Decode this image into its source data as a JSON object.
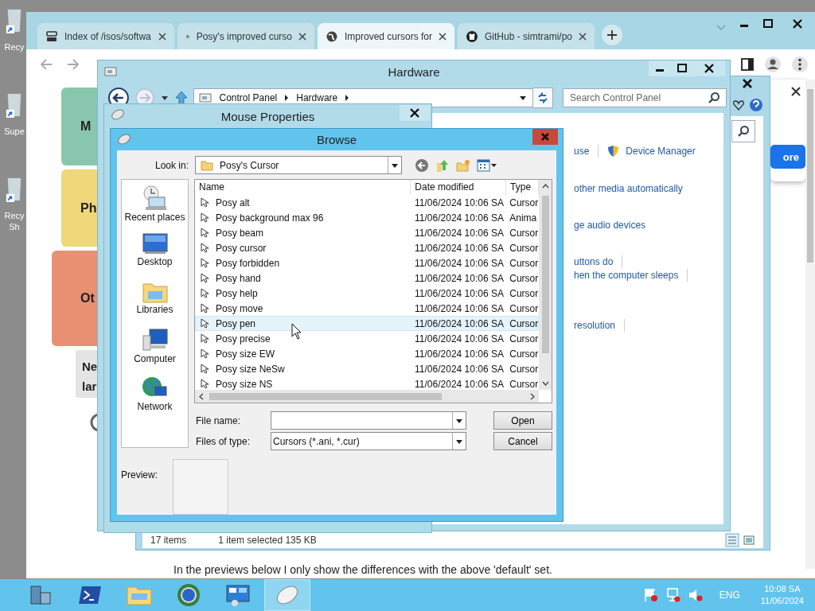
{
  "desktop_icons": [
    {
      "lines": [
        "Recy"
      ]
    },
    {
      "lines": [
        "Supe"
      ]
    },
    {
      "lines": [
        "Recy",
        "Sh"
      ]
    }
  ],
  "browser": {
    "tabs": [
      {
        "title": "Index of /isos/softwa",
        "kind": "server",
        "selected": false
      },
      {
        "title": "Posy's improved curso",
        "kind": "asterisk",
        "selected": false
      },
      {
        "title": "Improved cursors for",
        "kind": "globe",
        "selected": true
      },
      {
        "title": "GitHub - simtrami/po",
        "kind": "cat",
        "selected": false
      }
    ],
    "page": {
      "cards": [
        {
          "label": "M",
          "color": "#88c7ae"
        },
        {
          "label": "Ph",
          "color": "#efd77a"
        },
        {
          "label": "Ot",
          "color": "#e89172"
        }
      ],
      "note_lines": [
        "Ne",
        "lar"
      ],
      "popup_button": "ore",
      "paragraph": "In the previews below I only show the differences with the above 'default' set."
    }
  },
  "control_panel_back": {
    "status": [
      "17 items",
      "1 item selected  135 KB"
    ]
  },
  "hardware": {
    "title": "Hardware",
    "breadcrumb": [
      "Control Panel",
      "Hardware"
    ],
    "search_placeholder": "Search Control Panel",
    "link_rows": [
      {
        "links": [
          {
            "text": "use",
            "kind": "plain"
          },
          {
            "text": "Device Manager",
            "kind": "shield"
          }
        ],
        "trailing_separator": false
      },
      {
        "links": [
          {
            "text": "other media automatically",
            "kind": "plain"
          }
        ],
        "trailing_separator": false
      },
      {
        "links": [
          {
            "text": "ge audio devices",
            "kind": "plain"
          }
        ],
        "trailing_separator": false
      },
      {
        "links": [
          {
            "text": "uttons do",
            "kind": "plain"
          }
        ],
        "trailing_separator": true
      },
      {
        "links": [
          {
            "text": "hen the computer sleeps",
            "kind": "plain"
          }
        ],
        "trailing_separator": true
      },
      {
        "links": [
          {
            "text": "resolution",
            "kind": "plain"
          }
        ],
        "trailing_separator": true
      }
    ]
  },
  "mouse_properties": {
    "title": "Mouse Properties"
  },
  "browse": {
    "title": "Browse",
    "look_in_label": "Look in:",
    "look_in": "Posy's Cursor",
    "places": [
      {
        "label": "Recent places",
        "kind": "recent"
      },
      {
        "label": "Desktop",
        "kind": "desktop"
      },
      {
        "label": "Libraries",
        "kind": "libraries"
      },
      {
        "label": "Computer",
        "kind": "computer"
      },
      {
        "label": "Network",
        "kind": "network"
      }
    ],
    "columns": [
      "Name",
      "Date modified",
      "Type"
    ],
    "files": [
      {
        "name": "Posy alt",
        "date": "11/06/2024 10:06 SA",
        "type": "Cursor",
        "hovered": false
      },
      {
        "name": "Posy background max 96",
        "date": "11/06/2024 10:06 SA",
        "type": "Anima",
        "hovered": false
      },
      {
        "name": "Posy beam",
        "date": "11/06/2024 10:06 SA",
        "type": "Cursor",
        "hovered": false
      },
      {
        "name": "Posy cursor",
        "date": "11/06/2024 10:06 SA",
        "type": "Cursor",
        "hovered": false
      },
      {
        "name": "Posy forbidden",
        "date": "11/06/2024 10:06 SA",
        "type": "Cursor",
        "hovered": false
      },
      {
        "name": "Posy hand",
        "date": "11/06/2024 10:06 SA",
        "type": "Cursor",
        "hovered": false
      },
      {
        "name": "Posy help",
        "date": "11/06/2024 10:06 SA",
        "type": "Cursor",
        "hovered": false
      },
      {
        "name": "Posy move",
        "date": "11/06/2024 10:06 SA",
        "type": "Cursor",
        "hovered": false
      },
      {
        "name": "Posy pen",
        "date": "11/06/2024 10:06 SA",
        "type": "Cursor",
        "hovered": true
      },
      {
        "name": "Posy precise",
        "date": "11/06/2024 10:06 SA",
        "type": "Cursor",
        "hovered": false
      },
      {
        "name": "Posy size EW",
        "date": "11/06/2024 10:06 SA",
        "type": "Cursor",
        "hovered": false
      },
      {
        "name": "Posy size NeSw",
        "date": "11/06/2024 10:06 SA",
        "type": "Cursor",
        "hovered": false
      },
      {
        "name": "Posy size NS",
        "date": "11/06/2024 10:06 SA",
        "type": "Cursor",
        "hovered": false
      }
    ],
    "file_name_label": "File name:",
    "file_type_label": "Files of type:",
    "file_type": "Cursors (*.ani, *.cur)",
    "buttons": [
      "Open",
      "Cancel"
    ],
    "preview_label": "Preview:"
  },
  "taskbar": {
    "apps": [
      {
        "kind": "server-manager",
        "active": false
      },
      {
        "kind": "powershell",
        "active": false
      },
      {
        "kind": "explorer",
        "active": false
      },
      {
        "kind": "browser",
        "active": false
      },
      {
        "kind": "control-panel",
        "active": false
      },
      {
        "kind": "mouse",
        "active": true
      }
    ],
    "language": "ENG",
    "time": "10:08 SA",
    "date": "11/06/2024"
  }
}
